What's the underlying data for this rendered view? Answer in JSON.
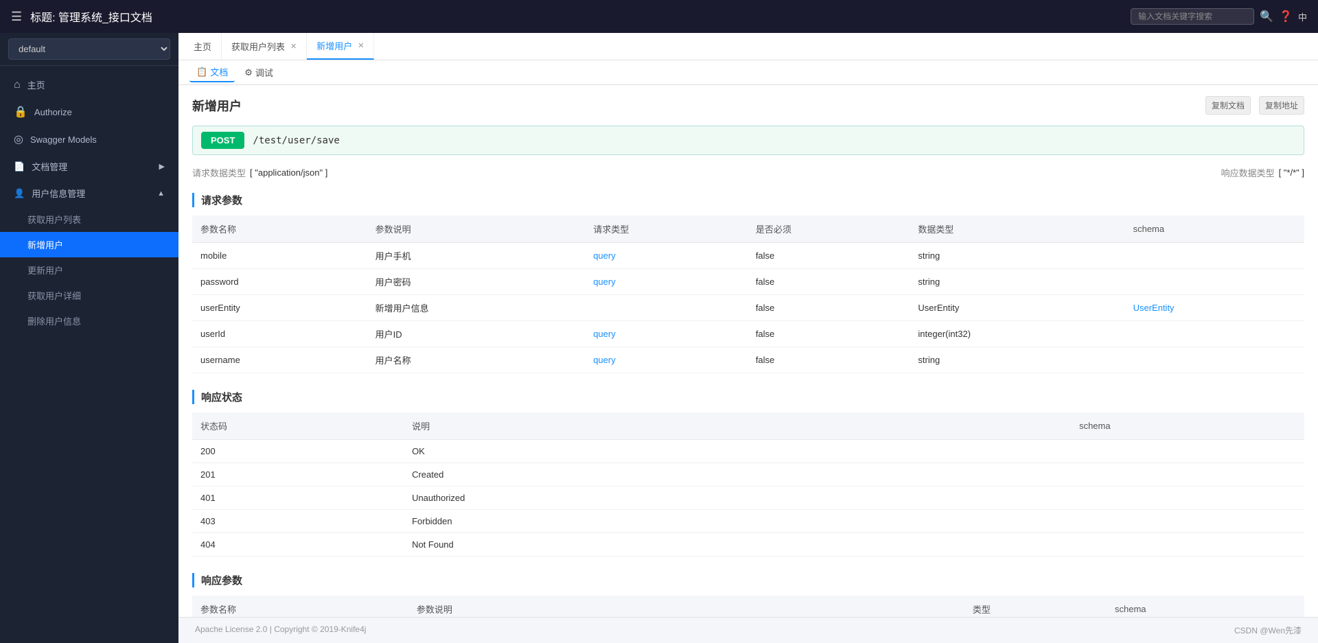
{
  "header": {
    "menu_icon": "☰",
    "title": "标题: 管理系统_接口文档",
    "search_placeholder": "输入文档关键字搜索",
    "search_icon": "🔍",
    "help_icon": "?",
    "lang_btn": "中"
  },
  "sidebar": {
    "select_default": "default",
    "items": [
      {
        "id": "home",
        "label": "主页",
        "icon": "⌂"
      },
      {
        "id": "authorize",
        "label": "Authorize",
        "icon": "🔒"
      },
      {
        "id": "swagger-models",
        "label": "Swagger Models",
        "icon": "◎"
      },
      {
        "id": "doc-manage",
        "label": "文档管理",
        "icon": "📄",
        "has_arrow": true
      }
    ],
    "groups": [
      {
        "id": "user-manage",
        "label": "用户信息管理",
        "icon": "👤",
        "expanded": true,
        "children": [
          {
            "id": "get-user-list",
            "label": "获取用户列表"
          },
          {
            "id": "add-user",
            "label": "新增用户",
            "active": true
          },
          {
            "id": "update-user",
            "label": "更新用户"
          },
          {
            "id": "get-user-detail",
            "label": "获取用户详细"
          },
          {
            "id": "delete-user",
            "label": "删除用户信息"
          }
        ]
      }
    ]
  },
  "tabs": [
    {
      "id": "home",
      "label": "主页",
      "closable": false
    },
    {
      "id": "get-user-list",
      "label": "获取用户列表",
      "closable": true
    },
    {
      "id": "add-user",
      "label": "新增用户",
      "closable": true,
      "active": true
    }
  ],
  "sub_nav": [
    {
      "id": "doc",
      "label": "文档",
      "icon": "📋",
      "active": true
    },
    {
      "id": "test",
      "label": "调试",
      "icon": "⚙"
    }
  ],
  "content": {
    "page_title": "新增用户",
    "copy_doc_label": "复制文档",
    "copy_url_label": "复制地址",
    "endpoint": {
      "method": "POST",
      "path": "/test/user/save"
    },
    "meta": {
      "request_type_label": "请求数据类型",
      "request_type_value": "[ \"application/json\" ]",
      "response_type_label": "响应数据类型",
      "response_type_value": "[ \"*/*\" ]"
    },
    "request_params": {
      "section_title": "请求参数",
      "headers": [
        "参数名称",
        "参数说明",
        "请求类型",
        "是否必须",
        "数据类型",
        "schema"
      ],
      "rows": [
        {
          "name": "mobile",
          "desc": "用户手机",
          "req_type": "query",
          "required": "false",
          "data_type": "string",
          "schema": ""
        },
        {
          "name": "password",
          "desc": "用户密码",
          "req_type": "query",
          "required": "false",
          "data_type": "string",
          "schema": ""
        },
        {
          "name": "userEntity",
          "desc": "新增用户信息",
          "req_type": "",
          "required": "false",
          "data_type": "UserEntity",
          "schema": "UserEntity"
        },
        {
          "name": "userId",
          "desc": "用户ID",
          "req_type": "query",
          "required": "false",
          "data_type": "integer(int32)",
          "schema": ""
        },
        {
          "name": "username",
          "desc": "用户名称",
          "req_type": "query",
          "required": "false",
          "data_type": "string",
          "schema": ""
        }
      ]
    },
    "response_status": {
      "section_title": "响应状态",
      "headers": [
        "状态码",
        "说明",
        "",
        "",
        "",
        "schema"
      ],
      "rows": [
        {
          "code": "200",
          "desc": "OK",
          "schema": ""
        },
        {
          "code": "201",
          "desc": "Created",
          "schema": ""
        },
        {
          "code": "401",
          "desc": "Unauthorized",
          "schema": ""
        },
        {
          "code": "403",
          "desc": "Forbidden",
          "schema": ""
        },
        {
          "code": "404",
          "desc": "Not Found",
          "schema": ""
        }
      ]
    },
    "response_params": {
      "section_title": "响应参数",
      "headers": [
        "参数名称",
        "参数说明",
        "",
        "",
        "类型",
        "schema"
      ]
    }
  },
  "footer": {
    "license": "Apache License 2.0 | Copyright © 2019-Knife4j",
    "credit": "CSDN @Wen先漆"
  }
}
